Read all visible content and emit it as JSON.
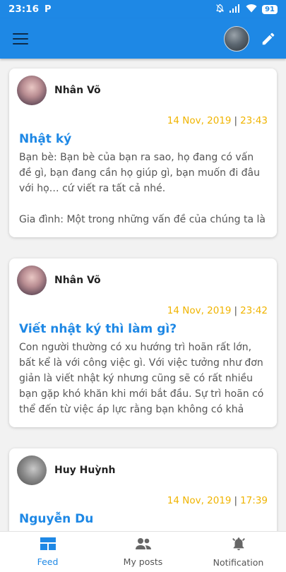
{
  "status_bar": {
    "time": "23:16",
    "app_indicator": "P",
    "battery": "91",
    "icons": [
      "bell-off-icon",
      "signal-icon",
      "wifi-icon",
      "battery-icon"
    ]
  },
  "app_bar": {
    "menu_icon": "menu-icon",
    "edit_icon": "pencil-icon"
  },
  "posts": [
    {
      "author": "Nhân Võ",
      "date": "14 Nov, 2019",
      "time": "23:43",
      "title": "Nhật ký",
      "body": "Bạn bè: Bạn bè của bạn ra sao, họ đang có vấn đề gì, bạn đang cần họ giúp gì, bạn muốn đi đâu với họ… cứ viết ra tất cả nhé.\n\nGia đình: Một trong những vấn đề của chúng ta là rất khó để bày tỏ tình cảm của mình với gia đình vì"
    },
    {
      "author": "Nhân Võ",
      "date": "14 Nov, 2019",
      "time": "23:42",
      "title": "Viết nhật ký thì làm gì?",
      "body": "Con người thường có xu hướng trì hoãn rất lớn, bất kể là với công việc gì. Với việc tưởng như đơn giản là viết nhật ký nhưng cũng sẽ có rất nhiều bạn gặp khó khăn khi mới bắt đầu. Sự trì hoãn có thể đến từ việc áp lực rằng bạn không có khả năng ghi chép cái gì hay ho, bạn sẽ viết những điều thật ấu trĩ, nếu"
    },
    {
      "author": "Huy Huỳnh",
      "date": "14 Nov, 2019",
      "time": "17:39",
      "title": "Nguyễn Du",
      "body": ""
    }
  ],
  "bottom_nav": [
    {
      "label": "Feed",
      "icon": "feed-icon",
      "active": true
    },
    {
      "label": "My posts",
      "icon": "people-icon",
      "active": false
    },
    {
      "label": "Notification",
      "icon": "bell-icon",
      "active": false
    }
  ],
  "colors": {
    "primary": "#1e88e5",
    "date": "#f0b400",
    "text": "#555555"
  }
}
